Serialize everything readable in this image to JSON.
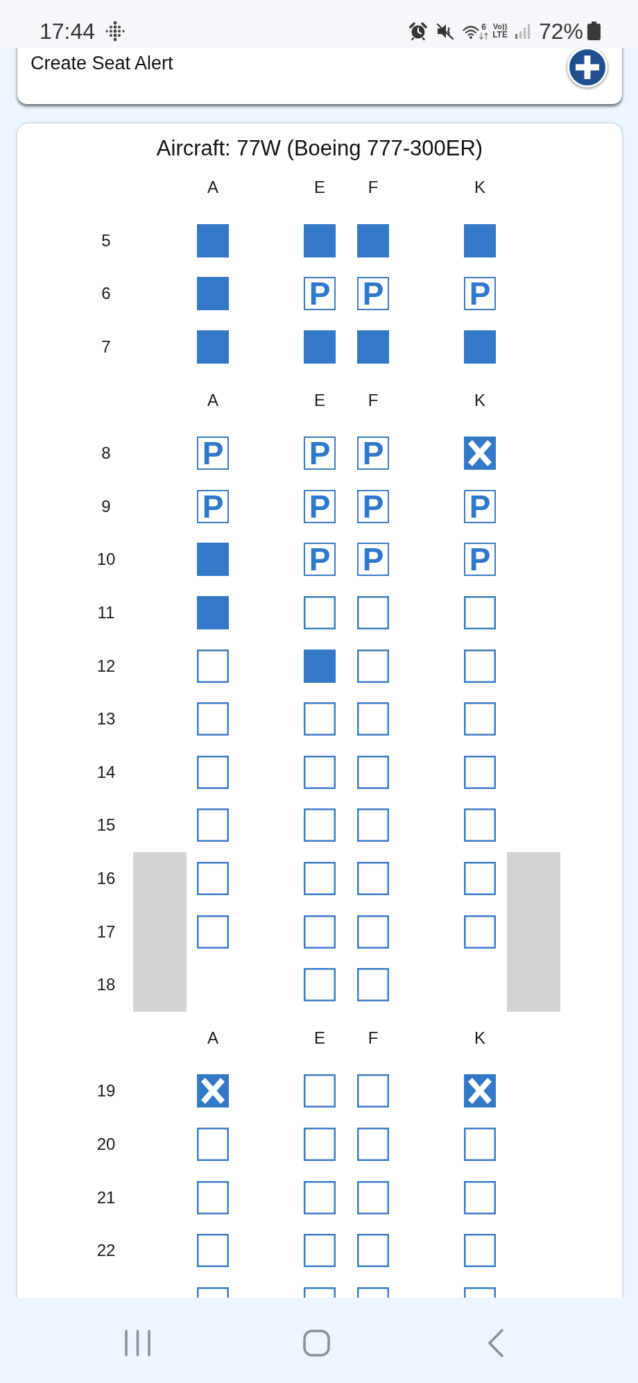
{
  "status_bar": {
    "time": "17:44",
    "wifi_badge": "6",
    "volte_top": "Vo))",
    "volte_bottom": "LTE",
    "battery": "72%"
  },
  "alert_card": {
    "label": "Create Seat Alert"
  },
  "seat_map": {
    "title": "Aircraft: 77W (Boeing 777-300ER)",
    "sections": [
      {
        "columns": [
          "A",
          "E",
          "F",
          "K"
        ],
        "rows": [
          {
            "number": "5",
            "wing": false,
            "seats": [
              {
                "kind": "filled"
              },
              {
                "kind": "filled"
              },
              {
                "kind": "filled"
              },
              {
                "kind": "filled"
              }
            ]
          },
          {
            "number": "6",
            "wing": false,
            "seats": [
              {
                "kind": "filled"
              },
              {
                "kind": "open",
                "label": "P"
              },
              {
                "kind": "open",
                "label": "P"
              },
              {
                "kind": "open",
                "label": "P"
              }
            ]
          },
          {
            "number": "7",
            "wing": false,
            "seats": [
              {
                "kind": "filled"
              },
              {
                "kind": "filled"
              },
              {
                "kind": "filled"
              },
              {
                "kind": "filled"
              }
            ]
          }
        ]
      },
      {
        "columns": [
          "A",
          "E",
          "F",
          "K"
        ],
        "rows": [
          {
            "number": "8",
            "wing": false,
            "seats": [
              {
                "kind": "open",
                "label": "P"
              },
              {
                "kind": "open",
                "label": "P"
              },
              {
                "kind": "open",
                "label": "P"
              },
              {
                "kind": "crossed"
              }
            ]
          },
          {
            "number": "9",
            "wing": false,
            "seats": [
              {
                "kind": "open",
                "label": "P"
              },
              {
                "kind": "open",
                "label": "P"
              },
              {
                "kind": "open",
                "label": "P"
              },
              {
                "kind": "open",
                "label": "P"
              }
            ]
          },
          {
            "number": "10",
            "wing": false,
            "seats": [
              {
                "kind": "filled"
              },
              {
                "kind": "open",
                "label": "P"
              },
              {
                "kind": "open",
                "label": "P"
              },
              {
                "kind": "open",
                "label": "P"
              }
            ]
          },
          {
            "number": "11",
            "wing": false,
            "seats": [
              {
                "kind": "filled"
              },
              {
                "kind": "open"
              },
              {
                "kind": "open"
              },
              {
                "kind": "open"
              }
            ]
          },
          {
            "number": "12",
            "wing": false,
            "seats": [
              {
                "kind": "open"
              },
              {
                "kind": "filled"
              },
              {
                "kind": "open"
              },
              {
                "kind": "open"
              }
            ]
          },
          {
            "number": "13",
            "wing": false,
            "seats": [
              {
                "kind": "open"
              },
              {
                "kind": "open"
              },
              {
                "kind": "open"
              },
              {
                "kind": "open"
              }
            ]
          },
          {
            "number": "14",
            "wing": false,
            "seats": [
              {
                "kind": "open"
              },
              {
                "kind": "open"
              },
              {
                "kind": "open"
              },
              {
                "kind": "open"
              }
            ]
          },
          {
            "number": "15",
            "wing": false,
            "seats": [
              {
                "kind": "open"
              },
              {
                "kind": "open"
              },
              {
                "kind": "open"
              },
              {
                "kind": "open"
              }
            ]
          },
          {
            "number": "16",
            "wing": true,
            "seats": [
              {
                "kind": "open"
              },
              {
                "kind": "open"
              },
              {
                "kind": "open"
              },
              {
                "kind": "open"
              }
            ]
          },
          {
            "number": "17",
            "wing": true,
            "seats": [
              {
                "kind": "open"
              },
              {
                "kind": "open"
              },
              {
                "kind": "open"
              },
              {
                "kind": "open"
              }
            ]
          },
          {
            "number": "18",
            "wing": true,
            "seats": [
              {
                "kind": "none"
              },
              {
                "kind": "open"
              },
              {
                "kind": "open"
              },
              {
                "kind": "none"
              }
            ]
          }
        ]
      },
      {
        "columns": [
          "A",
          "E",
          "F",
          "K"
        ],
        "rows": [
          {
            "number": "19",
            "wing": false,
            "seats": [
              {
                "kind": "crossed"
              },
              {
                "kind": "open"
              },
              {
                "kind": "open"
              },
              {
                "kind": "crossed"
              }
            ]
          },
          {
            "number": "20",
            "wing": false,
            "seats": [
              {
                "kind": "open"
              },
              {
                "kind": "open"
              },
              {
                "kind": "open"
              },
              {
                "kind": "open"
              }
            ]
          },
          {
            "number": "21",
            "wing": false,
            "seats": [
              {
                "kind": "open"
              },
              {
                "kind": "open"
              },
              {
                "kind": "open"
              },
              {
                "kind": "open"
              }
            ]
          },
          {
            "number": "22",
            "wing": false,
            "seats": [
              {
                "kind": "open"
              },
              {
                "kind": "open"
              },
              {
                "kind": "open"
              },
              {
                "kind": "open"
              }
            ]
          },
          {
            "wing": false,
            "seats": [
              {
                "kind": "open"
              },
              {
                "kind": "open"
              },
              {
                "kind": "open"
              },
              {
                "kind": "open"
              }
            ]
          }
        ]
      }
    ]
  }
}
